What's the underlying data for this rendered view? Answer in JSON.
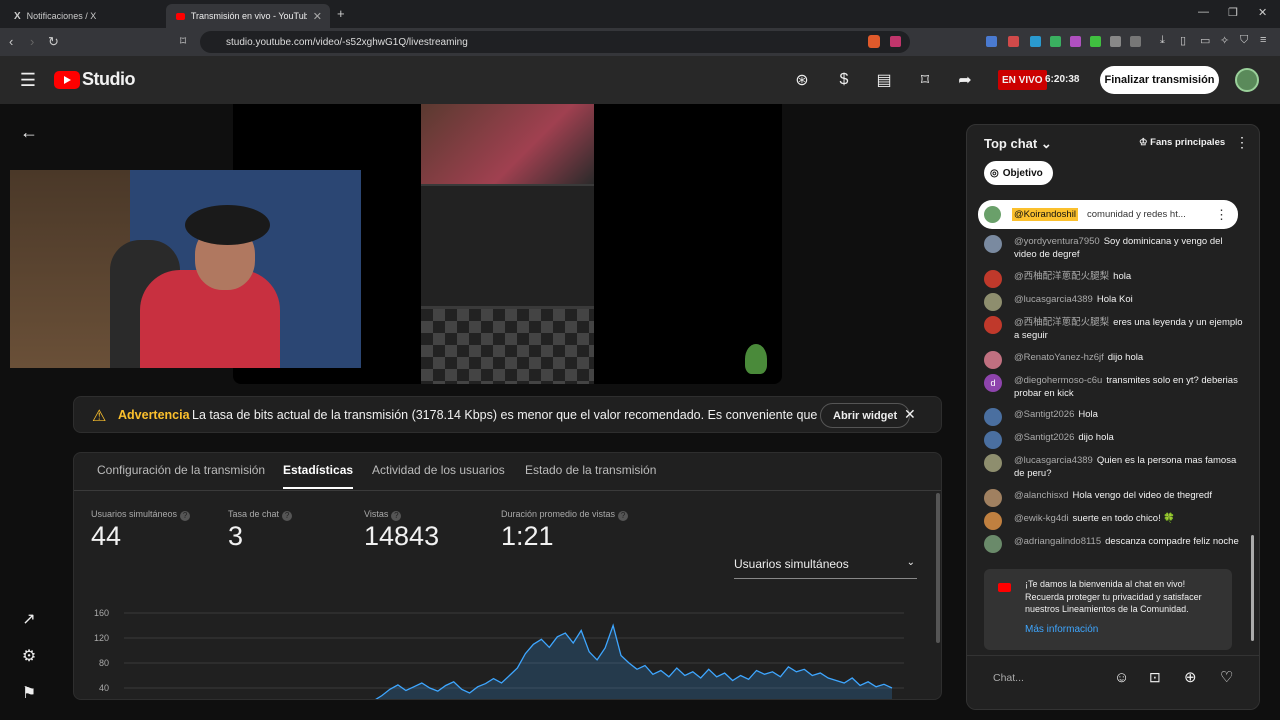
{
  "browser": {
    "tabs": [
      {
        "title": "Notificaciones / X",
        "active": false
      },
      {
        "title": "Transmisión en vivo - YouTube S",
        "active": true
      }
    ],
    "new_tab": "+",
    "url": "studio.youtube.com/video/-s52xghwG1Q/livestreaming"
  },
  "header": {
    "logo_text": "Studio",
    "live_badge": "EN VIVO",
    "live_time": "6:20:38",
    "end_button": "Finalizar transmisión"
  },
  "warning": {
    "title": "Advertencia",
    "message": "La tasa de bits actual de la transmisión (3178.14 Kbps) es menor que el valor recomendado. Es conveniente que uses ...",
    "button": "Abrir widget"
  },
  "panel": {
    "tabs": [
      "Configuración de la transmisión",
      "Estadísticas",
      "Actividad de los usuarios",
      "Estado de la transmisión"
    ],
    "active_tab": 1,
    "stats": [
      {
        "label": "Usuarios simultáneos",
        "value": "44"
      },
      {
        "label": "Tasa de chat",
        "value": "3"
      },
      {
        "label": "Vistas",
        "value": "14843"
      },
      {
        "label": "Duración promedio de vistas",
        "value": "1:21"
      }
    ],
    "metric_select": "Usuarios simultáneos",
    "chart_data": {
      "type": "area",
      "yticks": [
        "160",
        "120",
        "80",
        "40"
      ],
      "ylim": [
        40,
        160
      ],
      "color": "#3ea6ff",
      "values": [
        20,
        28,
        38,
        45,
        36,
        42,
        48,
        40,
        35,
        44,
        50,
        38,
        32,
        42,
        47,
        55,
        48,
        60,
        72,
        95,
        110,
        118,
        105,
        122,
        128,
        112,
        132,
        98,
        85,
        104,
        140,
        92,
        80,
        70,
        76,
        62,
        68,
        58,
        72,
        60,
        66,
        56,
        70,
        58,
        64,
        52,
        60,
        54,
        68,
        62,
        66,
        58,
        74,
        66,
        70,
        60,
        64,
        56,
        52,
        48,
        56,
        44,
        50,
        42,
        46,
        40
      ]
    }
  },
  "chat": {
    "title": "Top chat",
    "fans_button": "Fans principales",
    "goal_button": "Objetivo",
    "pinned": {
      "author": "@Koirandoshil",
      "text": "comunidad y redes ht..."
    },
    "messages": [
      {
        "author": "@yordyventura7950",
        "text": "Soy dominicana y vengo del video de degref",
        "color": "#7a8aa0"
      },
      {
        "author": "@西柚配洋蔥配火腿梨",
        "text": "hola",
        "color": "#c0392b"
      },
      {
        "author": "@lucasgarcia4389",
        "text": "Hola Koi",
        "color": "#8e8e6e"
      },
      {
        "author": "@西柚配洋蔥配火腿梨",
        "text": "eres una leyenda y un ejemplo a seguir",
        "color": "#c0392b"
      },
      {
        "author": "@RenatoYanez-hz6jf",
        "text": "dijo hola",
        "color": "#c07080"
      },
      {
        "author": "@diegohermoso-c6u",
        "text": "transmites solo en yt? deberias probar en kick",
        "color": "#8e44ad",
        "initial": "d"
      },
      {
        "author": "@Santigt2026",
        "text": "Hola",
        "color": "#4a6fa0"
      },
      {
        "author": "@Santigt2026",
        "text": "dijo hola",
        "color": "#4a6fa0"
      },
      {
        "author": "@lucasgarcia4389",
        "text": "Quien es la persona mas famosa de peru?",
        "color": "#8e8e6e"
      },
      {
        "author": "@alanchisxd",
        "text": "Hola vengo del video de thegredf",
        "color": "#a08060"
      },
      {
        "author": "@ewik-kg4di",
        "text": "suerte en todo chico! 🍀",
        "color": "#c08040"
      },
      {
        "author": "@adriangalindo8115",
        "text": "descanza compadre feliz noche",
        "color": "#6a8a6a"
      }
    ],
    "welcome": {
      "text": "¡Te damos la bienvenida al chat en vivo! Recuerda proteger tu privacidad y satisfacer nuestros Lineamientos de la Comunidad.",
      "link": "Más información"
    },
    "input_placeholder": "Chat..."
  }
}
